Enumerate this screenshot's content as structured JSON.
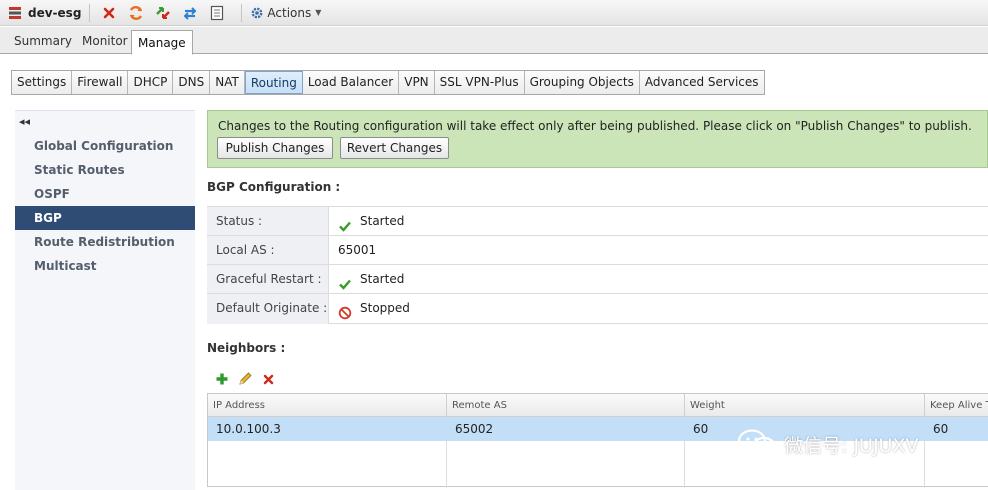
{
  "topbar": {
    "title": "dev-esg",
    "actions_label": "Actions"
  },
  "main_tabs": {
    "summary": "Summary",
    "monitor": "Monitor",
    "manage": "Manage"
  },
  "sub_tabs": [
    "Settings",
    "Firewall",
    "DHCP",
    "DNS",
    "NAT",
    "Routing",
    "Load Balancer",
    "VPN",
    "SSL VPN-Plus",
    "Grouping Objects",
    "Advanced Services"
  ],
  "sub_tabs_active": "Routing",
  "left_nav": {
    "collapse_glyph": "◂◂",
    "items": [
      "Global Configuration",
      "Static Routes",
      "OSPF",
      "BGP",
      "Route Redistribution",
      "Multicast"
    ],
    "active": "BGP"
  },
  "banner": {
    "message": "Changes to the Routing configuration will take effect only after being published. Please click on \"Publish Changes\" to publish.",
    "publish_label": "Publish Changes",
    "revert_label": "Revert Changes"
  },
  "bgp": {
    "heading": "BGP Configuration :",
    "rows": [
      {
        "label": "Status :",
        "value": "Started",
        "icon": "check-icon"
      },
      {
        "label": "Local AS :",
        "value": "65001",
        "icon": ""
      },
      {
        "label": "Graceful Restart :",
        "value": "Started",
        "icon": "check-icon"
      },
      {
        "label": "Default Originate :",
        "value": "Stopped",
        "icon": "stop-icon"
      }
    ]
  },
  "neighbors": {
    "heading": "Neighbors :",
    "columns": [
      "IP Address",
      "Remote AS",
      "Weight",
      "Keep Alive Tir"
    ],
    "rows": [
      [
        "10.0.100.3",
        "65002",
        "60",
        "60"
      ]
    ]
  },
  "watermark": {
    "text": "微信号: JUJUXV"
  },
  "colors": {
    "nav_active": "#2f4d74",
    "banner_bg": "#cce5b8",
    "row_selected": "#c3dff7",
    "check_green": "#3a9a2a",
    "stop_red": "#d23a2a"
  }
}
